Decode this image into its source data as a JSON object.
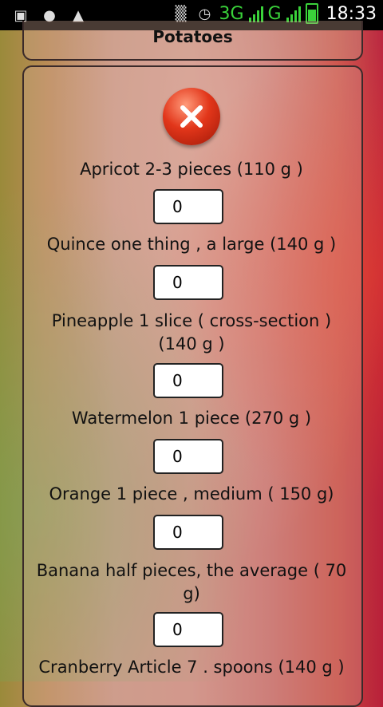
{
  "status_bar": {
    "network_primary": "3G",
    "network_secondary": "G",
    "time": "18:33",
    "left_icons": [
      "chat-icon",
      "android-icon",
      "android-robot-icon"
    ],
    "right_icons": [
      "vibrate-icon",
      "alarm-icon",
      "signal-icon",
      "battery-icon"
    ]
  },
  "top_panel": {
    "title": "Potatoes"
  },
  "items": [
    {
      "label": "Apricot 2-3 pieces (110 g )",
      "value": "0"
    },
    {
      "label": "Quince one thing , a large (140 g )",
      "value": "0"
    },
    {
      "label": "Pineapple 1 slice ( cross-section ) (140 g )",
      "value": "0"
    },
    {
      "label": "Watermelon 1 piece (270 g )",
      "value": "0"
    },
    {
      "label": "Orange 1 piece , medium ( 150 g)",
      "value": "0"
    },
    {
      "label": "Banana half pieces, the average ( 70 g)",
      "value": "0"
    },
    {
      "label": "Cranberry Article 7 . spoons (140 g )"
    }
  ]
}
